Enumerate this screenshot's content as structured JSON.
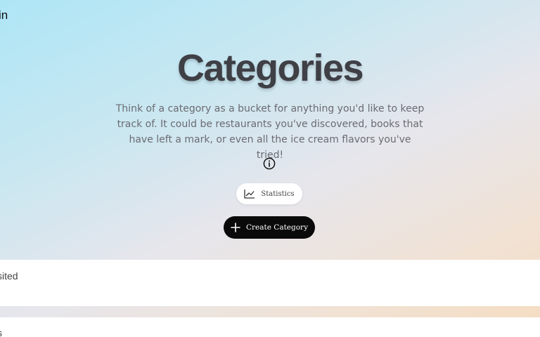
{
  "header": {
    "corner_text": "in"
  },
  "main": {
    "title": "Categories",
    "description": "Think of a category as a bucket for anything you'd like to keep track of. It could be restaurants you've discovered, books that have left a mark, or even all the ice cream flavors you've tried!",
    "info_icon": "info-circle-icon",
    "statistics_button": {
      "label": "Statistics",
      "icon": "line-chart-icon"
    },
    "create_button": {
      "label": "Create Category",
      "icon": "plus-icon"
    }
  },
  "categories": [
    {
      "label": "sited"
    },
    {
      "label": "s"
    }
  ],
  "colors": {
    "title": "#3f3f46",
    "primary_button": "#0a0a0a",
    "gradient_start": "#aee6f6",
    "gradient_end": "#f5dcc0"
  }
}
